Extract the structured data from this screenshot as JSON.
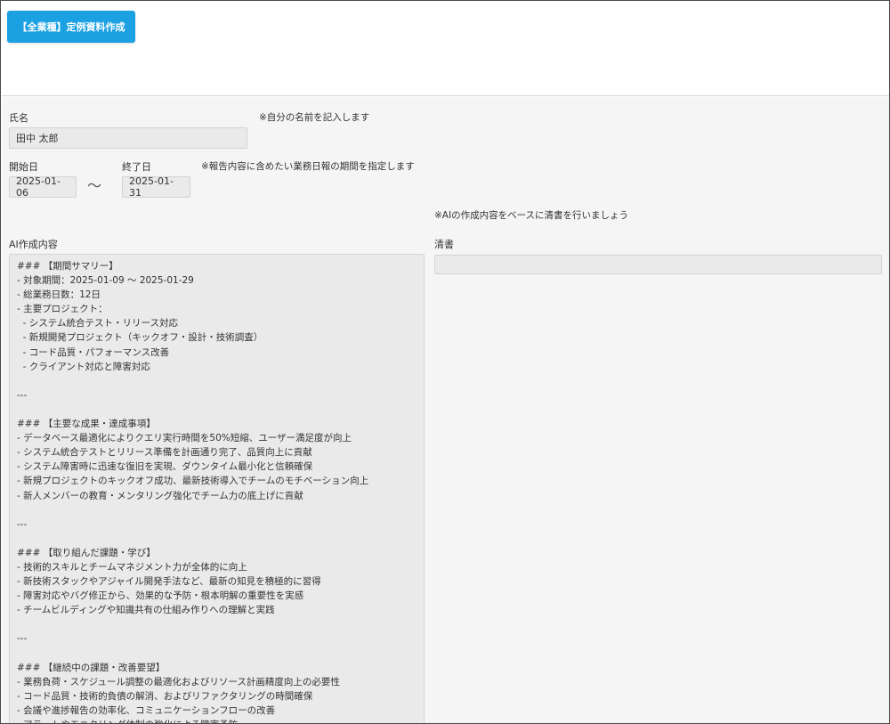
{
  "toolbar": {
    "action_label": "【全業種】定例資料作成"
  },
  "form": {
    "name": {
      "label": "氏名",
      "value": "田中 太郎",
      "note": "※自分の名前を記入します"
    },
    "period": {
      "start_label": "開始日",
      "start_value": "2025-01-06",
      "separator": "～",
      "end_label": "終了日",
      "end_value": "2025-01-31",
      "note": "※報告内容に含めたい業務日報の期間を指定します"
    },
    "clean_copy_note": "※AIの作成内容をベースに清書を行いましょう",
    "ai_content": {
      "label": "AI作成内容",
      "text": "### 【期間サマリー】\n- 対象期間：2025-01-09 ～ 2025-01-29\n- 総業務日数：12日\n- 主要プロジェクト：\n  - システム統合テスト・リリース対応\n  - 新規開発プロジェクト（キックオフ・設計・技術調査）\n  - コード品質・パフォーマンス改善\n  - クライアント対応と障害対応\n\n---\n\n### 【主要な成果・達成事項】\n- データベース最適化によりクエリ実行時間を50%短縮、ユーザー満足度が向上\n- システム統合テストとリリース準備を計画通り完了、品質向上に貢献\n- システム障害時に迅速な復旧を実現、ダウンタイム最小化と信頼確保\n- 新規プロジェクトのキックオフ成功、最新技術導入でチームのモチベーション向上\n- 新人メンバーの教育・メンタリング強化でチーム力の底上げに貢献\n\n---\n\n### 【取り組んだ課題・学び】\n- 技術的スキルとチームマネジメント力が全体的に向上\n- 新技術スタックやアジャイル開発手法など、最新の知見を積極的に習得\n- 障害対応やバグ修正から、効果的な予防・根本明解の重要性を実感\n- チームビルディングや知識共有の仕組み作りへの理解と実践\n\n---\n\n### 【継続中の課題・改善要望】\n- 業務負荷・スケジュール調整の最適化およびリソース計画精度向上の必要性\n- コード品質・技術的負債の解消、およびリファクタリングの時間確保\n- 会議や進捗報告の効率化、コミュニケーションフローの改善\n- アラートやモニタリング体制の強化による障害予防"
    },
    "clean_copy": {
      "label": "清書",
      "value": ""
    }
  },
  "colors": {
    "accent": "#1ba1e2",
    "field_bg": "#eaeaea",
    "content_bg": "#f5f5f5"
  }
}
